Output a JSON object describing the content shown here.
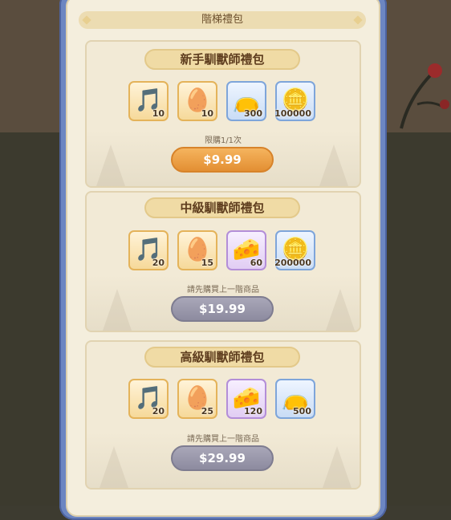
{
  "panel": {
    "title": "階梯禮包"
  },
  "packs": [
    {
      "name": "新手馴獸師禮包",
      "note": "限購1/1次",
      "price": "$9.99",
      "state": "active",
      "items": [
        {
          "icon": "lyre-icon",
          "glyph": "🎵",
          "rarity": "gold",
          "qty": "10"
        },
        {
          "icon": "egg-icon",
          "glyph": "🥚",
          "rarity": "gold",
          "qty": "10"
        },
        {
          "icon": "pet-food-bag-icon",
          "glyph": "👝",
          "rarity": "blue",
          "qty": "300"
        },
        {
          "icon": "gold-coin-icon",
          "glyph": "🪙",
          "rarity": "blue",
          "qty": "100000"
        }
      ]
    },
    {
      "name": "中級馴獸師禮包",
      "note": "請先購買上一階商品",
      "price": "$19.99",
      "state": "locked",
      "items": [
        {
          "icon": "lyre-icon",
          "glyph": "🎵",
          "rarity": "gold",
          "qty": "20"
        },
        {
          "icon": "egg-icon",
          "glyph": "🥚",
          "rarity": "gold",
          "qty": "15"
        },
        {
          "icon": "cheese-icon",
          "glyph": "🧀",
          "rarity": "purple",
          "qty": "60"
        },
        {
          "icon": "gold-coin-icon",
          "glyph": "🪙",
          "rarity": "blue",
          "qty": "200000"
        }
      ]
    },
    {
      "name": "高級馴獸師禮包",
      "note": "請先購買上一階商品",
      "price": "$29.99",
      "state": "locked",
      "items": [
        {
          "icon": "lyre-icon",
          "glyph": "🎵",
          "rarity": "gold",
          "qty": "20"
        },
        {
          "icon": "egg-icon",
          "glyph": "🥚",
          "rarity": "gold",
          "qty": "25"
        },
        {
          "icon": "cheese-icon",
          "glyph": "🧀",
          "rarity": "purple",
          "qty": "120"
        },
        {
          "icon": "pet-food-bag-icon",
          "glyph": "👝",
          "rarity": "blue",
          "qty": "500"
        }
      ]
    }
  ],
  "colors": {
    "frame": "#6c86c2",
    "panel": "#f4eedd",
    "buy_active": "#e38f33",
    "buy_locked": "#8d8b9f"
  }
}
